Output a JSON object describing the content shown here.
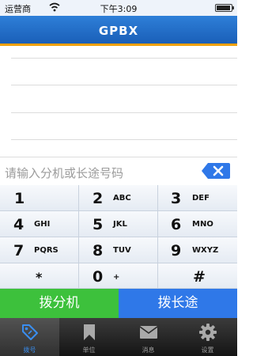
{
  "status_bar": {
    "carrier": "运营商",
    "time": "下午3:09"
  },
  "nav": {
    "title": "GPBX"
  },
  "input": {
    "placeholder": "请输入分机或长途号码"
  },
  "keypad": [
    {
      "digit": "1",
      "letters": ""
    },
    {
      "digit": "2",
      "letters": "ABC"
    },
    {
      "digit": "3",
      "letters": "DEF"
    },
    {
      "digit": "4",
      "letters": "GHI"
    },
    {
      "digit": "5",
      "letters": "JKL"
    },
    {
      "digit": "6",
      "letters": "MNO"
    },
    {
      "digit": "7",
      "letters": "PQRS"
    },
    {
      "digit": "8",
      "letters": "TUV"
    },
    {
      "digit": "9",
      "letters": "WXYZ"
    },
    {
      "digit": "*",
      "letters": ""
    },
    {
      "digit": "0",
      "letters": "+"
    },
    {
      "digit": "#",
      "letters": ""
    }
  ],
  "actions": {
    "extension": "拨分机",
    "long_distance": "拨长途"
  },
  "tabs": [
    {
      "label": "拨号",
      "icon": "tag-icon",
      "active": true
    },
    {
      "label": "单位",
      "icon": "bookmark-icon",
      "active": false
    },
    {
      "label": "消息",
      "icon": "envelope-icon",
      "active": false
    },
    {
      "label": "设置",
      "icon": "gear-icon",
      "active": false
    }
  ],
  "colors": {
    "nav": "#1a5fb8",
    "accent_line": "#f0a000",
    "call_extension": "#3dc13c",
    "call_long_distance": "#2f78e8",
    "tab_active": "#3a8ef0"
  }
}
